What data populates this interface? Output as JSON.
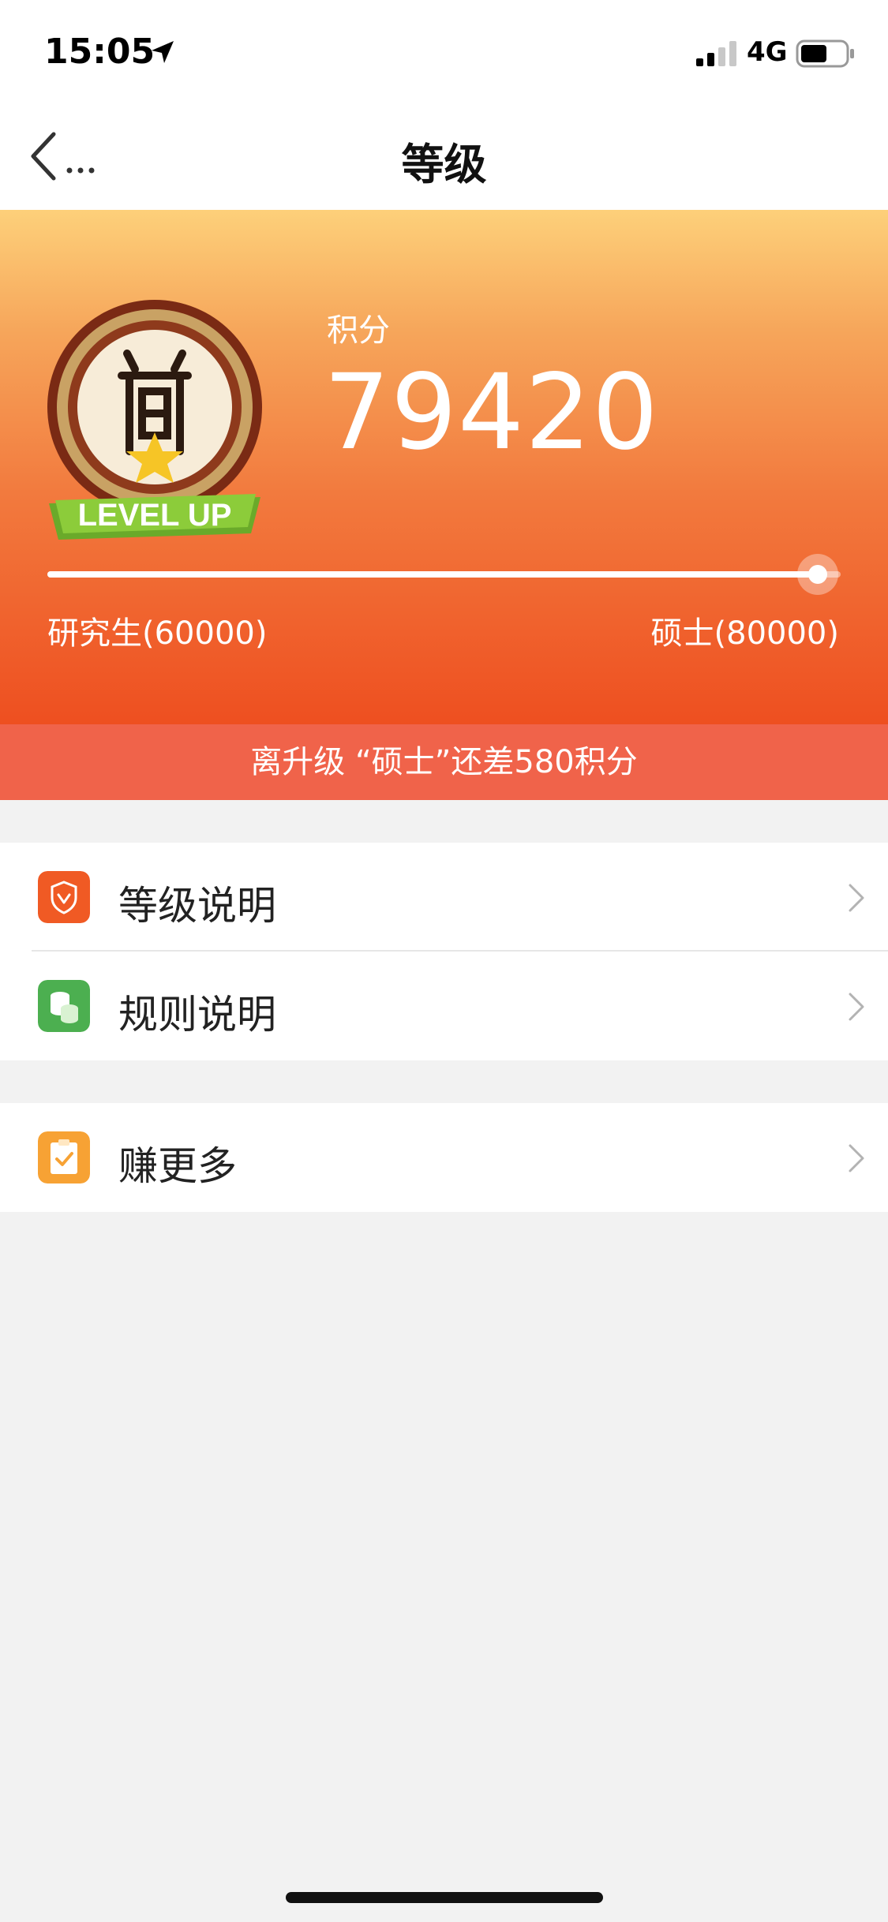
{
  "status_bar": {
    "time": "15:05",
    "network": "4G"
  },
  "navbar": {
    "back_label": "...",
    "title": "等级"
  },
  "hero": {
    "badge_text": "LEVEL UP",
    "points_label": "积分",
    "points_value": "79420",
    "progress_fraction": 0.971,
    "level_left": "研究生(60000)",
    "level_right": "硕士(80000)"
  },
  "banner": {
    "text": "离升级 “硕士”还差580积分"
  },
  "menu": {
    "level_desc": "等级说明",
    "rule_desc": "规则说明",
    "earn_more": "赚更多"
  },
  "colors": {
    "accent": "#ee4f20",
    "banner": "#f0634a",
    "icon_shield": "#f05a24",
    "icon_coins": "#4caf50",
    "icon_task": "#f7a234"
  }
}
